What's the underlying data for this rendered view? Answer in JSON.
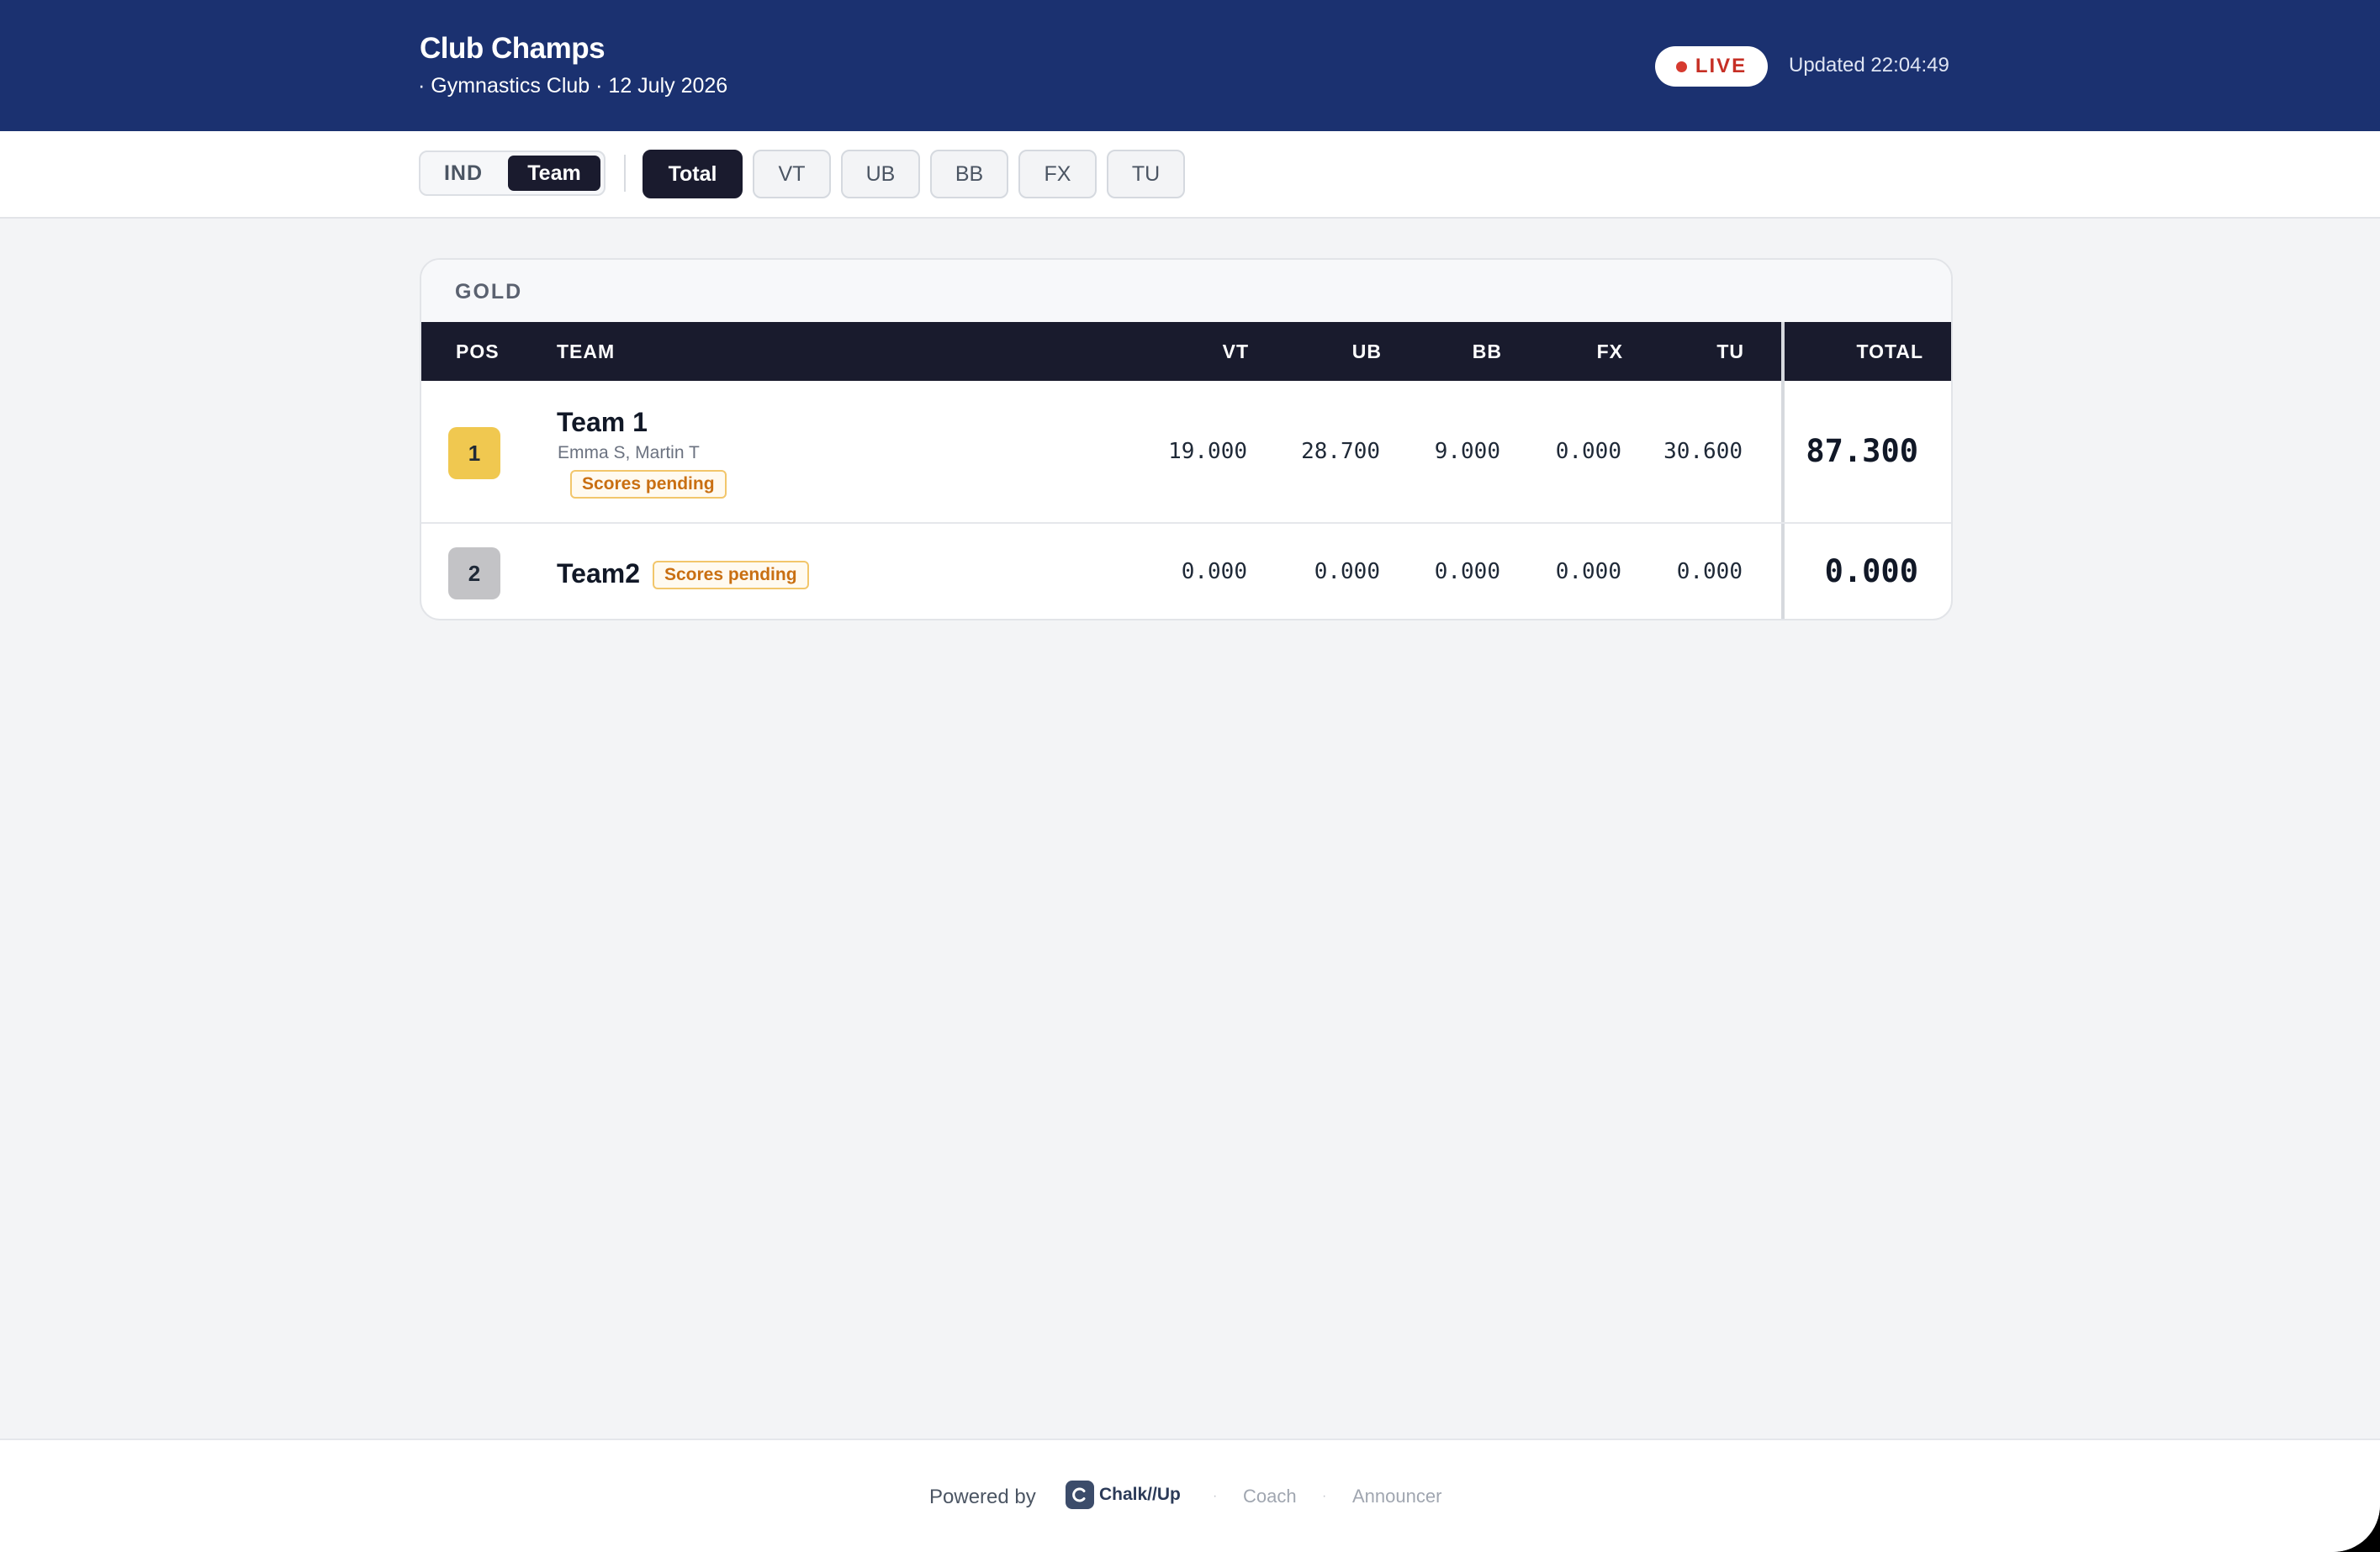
{
  "header": {
    "title": "Club Champs",
    "subtitle": "· Gymnastics Club · 12 July 2026",
    "live_label": "LIVE",
    "updated": "Updated 22:04:49",
    "live_color": "#d63a2f"
  },
  "filters": {
    "mode": {
      "ind": "IND",
      "team": "Team",
      "selected": "Team"
    },
    "apparatus": [
      "Total",
      "VT",
      "UB",
      "BB",
      "FX",
      "TU"
    ],
    "selected_apparatus": "Total"
  },
  "group": {
    "name": "GOLD",
    "columns": {
      "pos": "POS",
      "team": "TEAM",
      "vt": "VT",
      "ub": "UB",
      "bb": "BB",
      "fx": "FX",
      "tu": "TU",
      "total": "TOTAL"
    },
    "rows": [
      {
        "pos": "1",
        "team": "Team 1",
        "members": "Emma S, Martin T",
        "status": "Scores pending",
        "vt": "19.000",
        "ub": "28.700",
        "bb": "9.000",
        "fx": "0.000",
        "tu": "30.600",
        "total": "87.300",
        "pos_color": "#f0c850"
      },
      {
        "pos": "2",
        "team": "Team2",
        "status": "Scores pending",
        "vt": "0.000",
        "ub": "0.000",
        "bb": "0.000",
        "fx": "0.000",
        "tu": "0.000",
        "total": "0.000",
        "pos_color": "#c3c3c6"
      }
    ]
  },
  "footer": {
    "powered_by": "Powered by",
    "brand": "Chalk//Up",
    "links": [
      "Coach",
      "Announcer"
    ]
  }
}
